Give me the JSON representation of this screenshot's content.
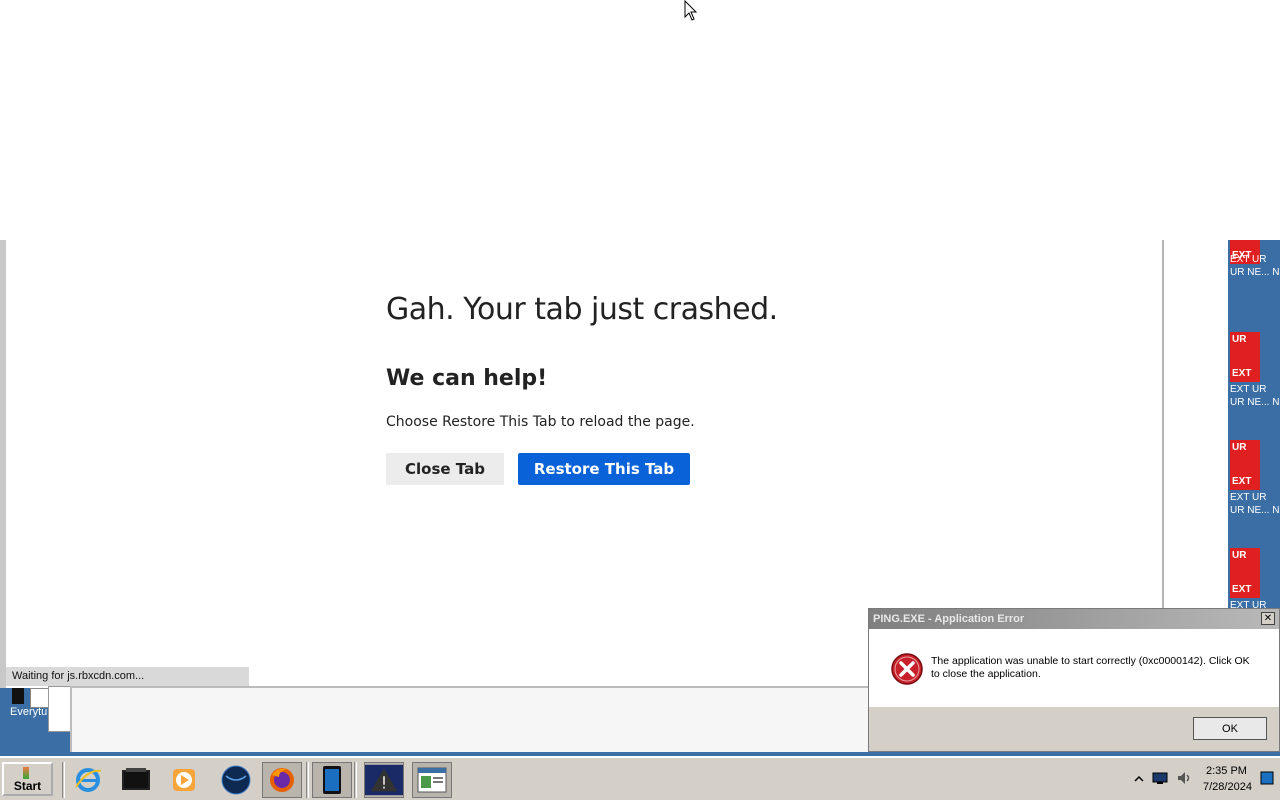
{
  "browser": {
    "crash": {
      "title": "Gah. Your tab just crashed.",
      "subtitle": "We can help!",
      "description": "Choose Restore This Tab to reload the page.",
      "close_label": "Close Tab",
      "restore_label": "Restore This Tab"
    },
    "status_text": "Waiting for js.rbxcdn.com..."
  },
  "desktop": {
    "icons": [
      {
        "line1": "",
        "line2": "EXT",
        "caption1": "EXT UR",
        "caption2": "UR NE... N"
      },
      {
        "line1": "UR",
        "line2": "EXT",
        "caption1": "EXT UR",
        "caption2": "UR NE... N"
      },
      {
        "line1": "UR",
        "line2": "EXT",
        "caption1": "EXT UR",
        "caption2": "UR NE... N"
      },
      {
        "line1": "UR",
        "line2": "EXT",
        "caption1": "EXT UR",
        "caption2": ""
      }
    ],
    "lower_label": "Everytu"
  },
  "dialog": {
    "title": "PING.EXE - Application Error",
    "close_glyph": "✕",
    "message": "The application was unable to start correctly (0xc0000142). Click OK to close the application.",
    "ok_label": "OK"
  },
  "taskbar": {
    "start_label": "Start",
    "items": [
      "ie-icon",
      "terminal-icon",
      "media-player-icon",
      "globe-icon",
      "firefox-icon",
      "tablet-icon",
      "warning-app-icon",
      "notepad-icon"
    ],
    "clock_time": "2:35 PM",
    "clock_date": "7/28/2024"
  }
}
